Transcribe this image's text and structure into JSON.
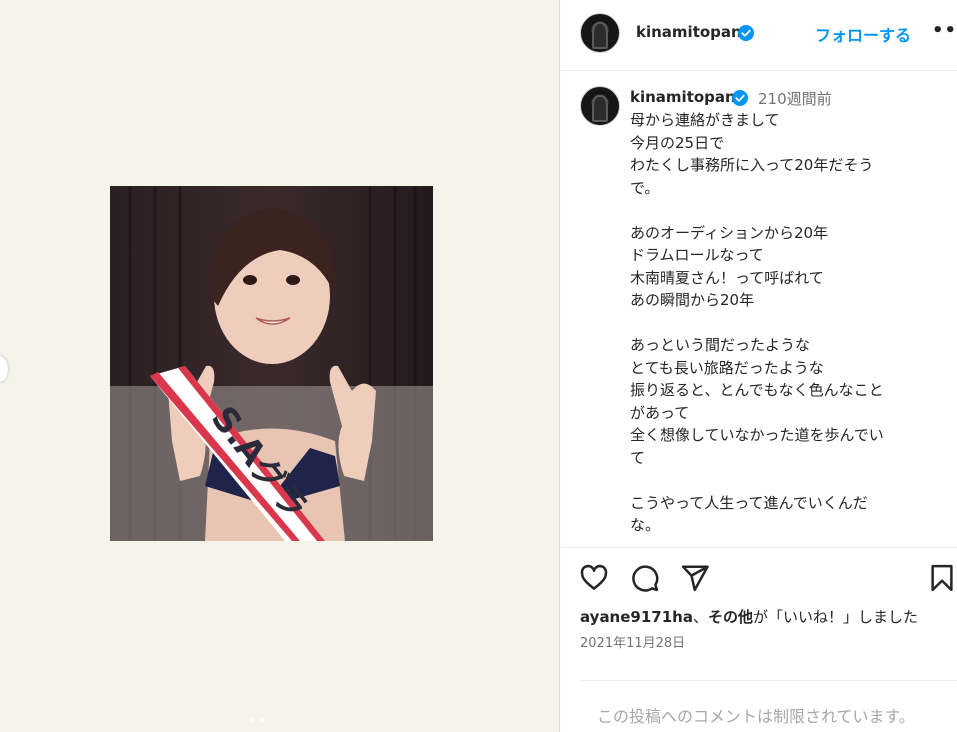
{
  "post": {
    "username": "kinamitopan",
    "follow_label": "フォローする",
    "more_label": "•••",
    "time_ago": "210週間前",
    "caption": "母から連絡がきまして\n今月の25日で\nわたくし事務所に入って20年だそう\nで。\n\nあのオーディションから20年\nドラムロールなって\n木南晴夏さん！って呼ばれて\nあの瞬間から20年\n\nあっという間だったような\nとても長い旅路だったような\n振り返ると、とんでもなく色んなこと\nがあって\n全く想像していなかった道を歩んでい\nて\n\nこうやって人生って進んでいくんだ\nな。",
    "sash_text": "S.Aグラ",
    "likes": {
      "user": "ayane9171ha",
      "separator": "、",
      "others": "その他",
      "suffix": "が「いいね！」しました"
    },
    "date": "2021年11月28日",
    "comments_restricted": "この投稿へのコメントは制限されています。"
  },
  "icons": {
    "verified": "verified-badge-icon",
    "like": "heart-icon",
    "comment": "comment-icon",
    "share": "send-icon",
    "save": "bookmark-icon"
  },
  "colors": {
    "accent": "#0095f6",
    "media_bg": "#f5f4ea",
    "muted": "#737373"
  }
}
